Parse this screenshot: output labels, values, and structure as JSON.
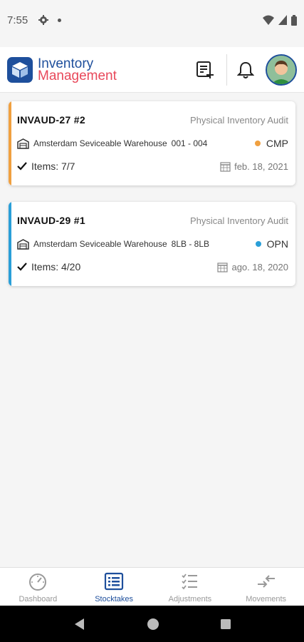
{
  "status_bar": {
    "time": "7:55"
  },
  "app": {
    "logo_line1": "Inventory",
    "logo_line2": "Management"
  },
  "cards": [
    {
      "code": "INVAUD-27 #2",
      "type": "Physical Inventory Audit",
      "warehouse": "Amsterdam Seviceable Warehouse",
      "range": "001 - 004",
      "status": "CMP",
      "status_color": "#f0a040",
      "accent_color": "#f0a040",
      "items": "Items: 7/7",
      "date": "feb. 18, 2021"
    },
    {
      "code": "INVAUD-29 #1",
      "type": "Physical Inventory Audit",
      "warehouse": "Amsterdam Seviceable Warehouse",
      "range": "8LB - 8LB",
      "status": "OPN",
      "status_color": "#2a9fd8",
      "accent_color": "#2a9fd8",
      "items": "Items: 4/20",
      "date": "ago. 18, 2020"
    }
  ],
  "bottom_nav": [
    {
      "label": "Dashboard",
      "icon": "speedometer-icon",
      "active": false
    },
    {
      "label": "Stocktakes",
      "icon": "list-icon",
      "active": true
    },
    {
      "label": "Adjustments",
      "icon": "checklist-icon",
      "active": false
    },
    {
      "label": "Movements",
      "icon": "transfer-arrows-icon",
      "active": false
    }
  ],
  "colors": {
    "brand_blue": "#1e4f9c",
    "brand_red": "#e8485a"
  }
}
